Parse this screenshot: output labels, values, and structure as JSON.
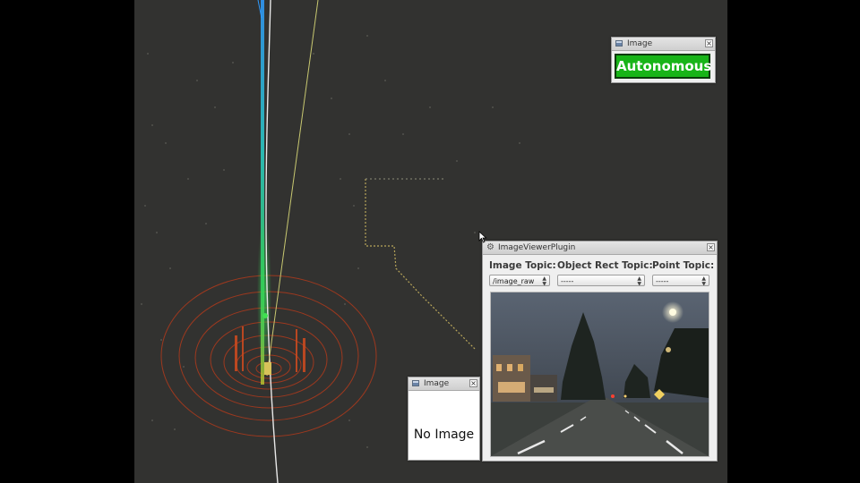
{
  "status_window": {
    "title": "Image",
    "status_label": "Autonomous",
    "status_color": "#18b418"
  },
  "noimage_window": {
    "title": "Image",
    "message": "No Image"
  },
  "viewer_window": {
    "title": "ImageViewerPlugin",
    "image_topic": {
      "label": "Image Topic:",
      "value": "/image_raw"
    },
    "rect_topic": {
      "label": "Object Rect Topic:",
      "value": "-----"
    },
    "point_topic": {
      "label": "Point Topic:",
      "value": "-----"
    }
  },
  "icons": {
    "window": "window-icon",
    "gear": "gear-icon",
    "close": "close-icon",
    "cursor": "mouse-cursor-icon"
  }
}
